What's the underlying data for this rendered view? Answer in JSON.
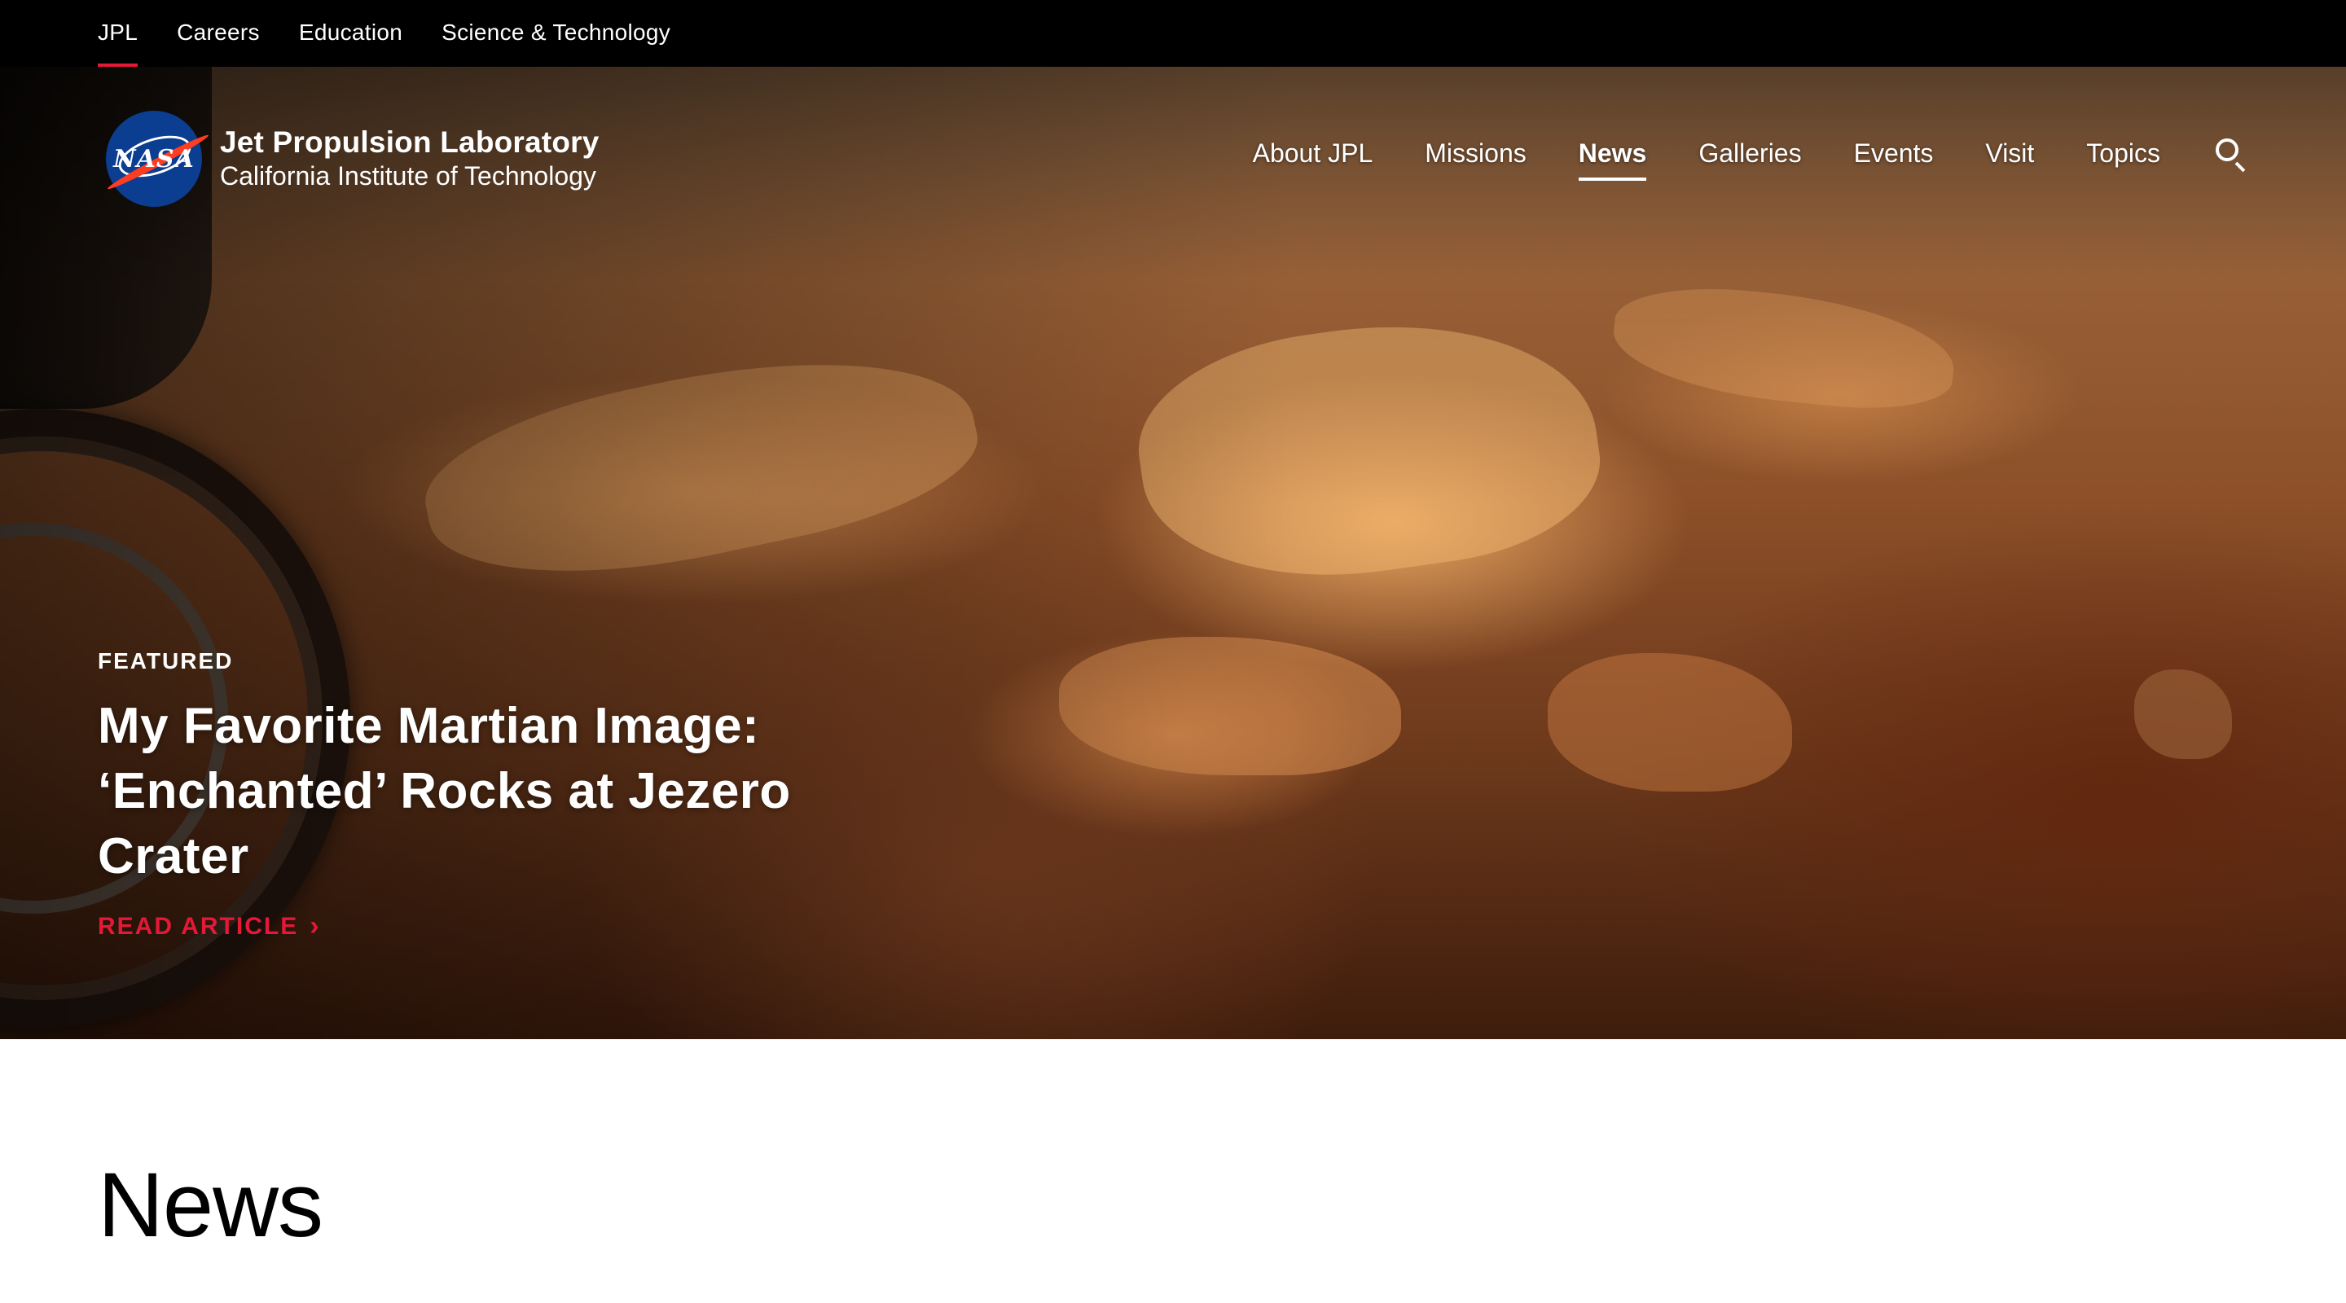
{
  "utility_nav": {
    "items": [
      {
        "label": "JPL",
        "active": true
      },
      {
        "label": "Careers",
        "active": false
      },
      {
        "label": "Education",
        "active": false
      },
      {
        "label": "Science & Technology",
        "active": false
      }
    ]
  },
  "header": {
    "logo": {
      "badge_text": "NASA",
      "title": "Jet Propulsion Laboratory",
      "subtitle": "California Institute of Technology"
    },
    "nav": [
      {
        "label": "About JPL",
        "active": false
      },
      {
        "label": "Missions",
        "active": false
      },
      {
        "label": "News",
        "active": true
      },
      {
        "label": "Galleries",
        "active": false
      },
      {
        "label": "Events",
        "active": false
      },
      {
        "label": "Visit",
        "active": false
      },
      {
        "label": "Topics",
        "active": false
      }
    ],
    "search_icon": "search-icon"
  },
  "hero": {
    "eyebrow": "FEATURED",
    "title": "My Favorite Martian Image: ‘Enchanted’ Rocks at Jezero Crater",
    "cta_label": "READ ARTICLE",
    "cta_icon": "chevron-right-icon"
  },
  "main": {
    "heading": "News"
  },
  "colors": {
    "accent": "#e31937",
    "utility_bar_bg": "#000000",
    "nasa_blue": "#0b3d91",
    "nasa_red": "#fc3d21"
  }
}
